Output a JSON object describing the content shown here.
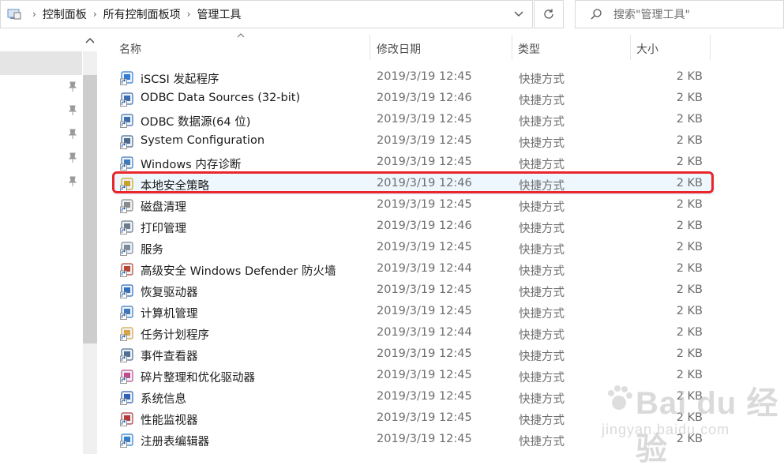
{
  "address": {
    "crumbs": [
      "控制面板",
      "所有控制面板项",
      "管理工具"
    ],
    "icon": "control-panel-icon"
  },
  "search": {
    "placeholder": "搜索\"管理工具\""
  },
  "columns": {
    "name": "名称",
    "date": "修改日期",
    "type": "类型",
    "size": "大小"
  },
  "files": [
    {
      "name": "iSCSI 发起程序",
      "date": "2019/3/19 12:45",
      "type": "快捷方式",
      "size": "2 KB",
      "icon": "iscsi-icon",
      "color": "#2e7dd6"
    },
    {
      "name": "ODBC Data Sources (32-bit)",
      "date": "2019/3/19 12:46",
      "type": "快捷方式",
      "size": "2 KB",
      "icon": "odbc-icon",
      "color": "#3b6db3"
    },
    {
      "name": "ODBC 数据源(64 位)",
      "date": "2019/3/19 12:45",
      "type": "快捷方式",
      "size": "2 KB",
      "icon": "odbc-icon",
      "color": "#3b6db3"
    },
    {
      "name": "System Configuration",
      "date": "2019/3/19 12:45",
      "type": "快捷方式",
      "size": "2 KB",
      "icon": "system-config-icon",
      "color": "#4a6a8f"
    },
    {
      "name": "Windows 内存诊断",
      "date": "2019/3/19 12:45",
      "type": "快捷方式",
      "size": "2 KB",
      "icon": "memory-diagnostic-icon",
      "color": "#3d7bbf"
    },
    {
      "name": "本地安全策略",
      "date": "2019/3/19 12:46",
      "type": "快捷方式",
      "size": "2 KB",
      "icon": "security-policy-icon",
      "color": "#c9a227"
    },
    {
      "name": "磁盘清理",
      "date": "2019/3/19 12:45",
      "type": "快捷方式",
      "size": "2 KB",
      "icon": "disk-cleanup-icon",
      "color": "#8a8a8a"
    },
    {
      "name": "打印管理",
      "date": "2019/3/19 12:46",
      "type": "快捷方式",
      "size": "2 KB",
      "icon": "print-management-icon",
      "color": "#6b7b8c"
    },
    {
      "name": "服务",
      "date": "2019/3/19 12:45",
      "type": "快捷方式",
      "size": "2 KB",
      "icon": "services-icon",
      "color": "#7a8a99"
    },
    {
      "name": "高级安全 Windows Defender 防火墙",
      "date": "2019/3/19 12:44",
      "type": "快捷方式",
      "size": "2 KB",
      "icon": "firewall-icon",
      "color": "#b8452f"
    },
    {
      "name": "恢复驱动器",
      "date": "2019/3/19 12:45",
      "type": "快捷方式",
      "size": "2 KB",
      "icon": "recovery-drive-icon",
      "color": "#2f6fc0"
    },
    {
      "name": "计算机管理",
      "date": "2019/3/19 12:45",
      "type": "快捷方式",
      "size": "2 KB",
      "icon": "computer-management-icon",
      "color": "#3a78c2"
    },
    {
      "name": "任务计划程序",
      "date": "2019/3/19 12:44",
      "type": "快捷方式",
      "size": "2 KB",
      "icon": "task-scheduler-icon",
      "color": "#d9a441"
    },
    {
      "name": "事件查看器",
      "date": "2019/3/19 12:45",
      "type": "快捷方式",
      "size": "2 KB",
      "icon": "event-viewer-icon",
      "color": "#4d6f96"
    },
    {
      "name": "碎片整理和优化驱动器",
      "date": "2019/3/19 12:45",
      "type": "快捷方式",
      "size": "2 KB",
      "icon": "defrag-icon",
      "color": "#c14b8d"
    },
    {
      "name": "系统信息",
      "date": "2019/3/19 12:45",
      "type": "快捷方式",
      "size": "2 KB",
      "icon": "system-info-icon",
      "color": "#2d62b5"
    },
    {
      "name": "性能监视器",
      "date": "2019/3/19 12:45",
      "type": "快捷方式",
      "size": "2 KB",
      "icon": "performance-monitor-icon",
      "color": "#b33a3a"
    },
    {
      "name": "注册表编辑器",
      "date": "2019/3/19 12:45",
      "type": "快捷方式",
      "size": "2 KB",
      "icon": "registry-editor-icon",
      "color": "#2f7fcf"
    }
  ],
  "highlighted_index": 5,
  "watermark": {
    "text": "Bai du 经验",
    "sub": "jingyan.baidu.com"
  }
}
